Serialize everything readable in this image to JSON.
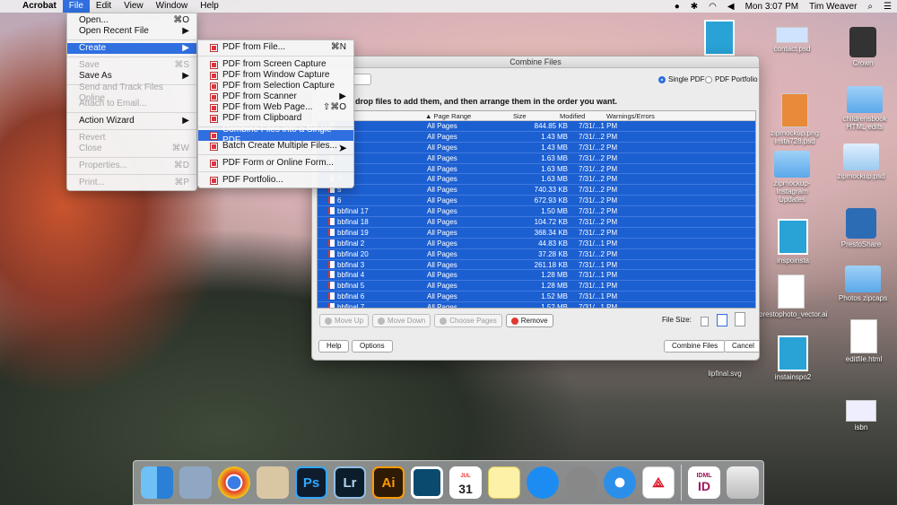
{
  "menubar": {
    "apple": "",
    "app_name": "Acrobat",
    "items": [
      "File",
      "Edit",
      "View",
      "Window",
      "Help"
    ],
    "active": "File",
    "clock": "Mon 3:07 PM",
    "user": "Tim Weaver"
  },
  "file_menu": [
    {
      "label": "Open...",
      "shortcut": "⌘O"
    },
    {
      "label": "Open Recent File",
      "shortcut": "▶"
    },
    {
      "sep": true
    },
    {
      "label": "Create",
      "shortcut": "▶",
      "highlight": true
    },
    {
      "sep": true
    },
    {
      "label": "Save",
      "shortcut": "⌘S",
      "disabled": true
    },
    {
      "label": "Save As",
      "shortcut": "▶"
    },
    {
      "sep": true
    },
    {
      "label": "Send and Track Files Online",
      "disabled": true
    },
    {
      "label": "Attach to Email...",
      "disabled": true
    },
    {
      "sep": true
    },
    {
      "label": "Action Wizard",
      "shortcut": "▶"
    },
    {
      "sep": true
    },
    {
      "label": "Revert",
      "disabled": true
    },
    {
      "label": "Close",
      "shortcut": "⌘W",
      "disabled": true
    },
    {
      "sep": true
    },
    {
      "label": "Properties...",
      "shortcut": "⌘D",
      "disabled": true
    },
    {
      "sep": true
    },
    {
      "label": "Print...",
      "shortcut": "⌘P",
      "disabled": true
    }
  ],
  "create_menu": [
    {
      "label": "PDF from File...",
      "shortcut": "⌘N"
    },
    {
      "sep": true
    },
    {
      "label": "PDF from Screen Capture"
    },
    {
      "label": "PDF from Window Capture"
    },
    {
      "label": "PDF from Selection Capture"
    },
    {
      "label": "PDF from Scanner",
      "shortcut": "▶"
    },
    {
      "label": "PDF from Web Page...",
      "shortcut": "⇧⌘O"
    },
    {
      "label": "PDF from Clipboard"
    },
    {
      "sep": true
    },
    {
      "label": "Combine Files into a Single PDF...",
      "highlight": true
    },
    {
      "label": "Batch Create Multiple Files..."
    },
    {
      "sep": true
    },
    {
      "label": "PDF Form or Online Form..."
    },
    {
      "sep": true
    },
    {
      "label": "PDF Portfolio..."
    }
  ],
  "combine_window": {
    "title": "Combine Files",
    "dropdown": "...",
    "radio_single": "Single PDF",
    "radio_portfolio": "PDF Portfolio",
    "instruction": "drop files to add them, and then arrange them in the order you want.",
    "columns": {
      "range": "Page Range",
      "size": "Size",
      "modified": "Modified",
      "warnings": "Warnings/Errors"
    },
    "rows": [
      {
        "name": "",
        "range": "All Pages",
        "size": "844.85 KB",
        "modified": "7/31/...1 PM"
      },
      {
        "name": "0",
        "range": "All Pages",
        "size": "1.43 MB",
        "modified": "7/31/...2 PM"
      },
      {
        "name": "1",
        "range": "All Pages",
        "size": "1.43 MB",
        "modified": "7/31/...2 PM"
      },
      {
        "name": "2",
        "range": "All Pages",
        "size": "1.63 MB",
        "modified": "7/31/...2 PM"
      },
      {
        "name": "3",
        "range": "All Pages",
        "size": "1.63 MB",
        "modified": "7/31/...2 PM"
      },
      {
        "name": "4",
        "range": "All Pages",
        "size": "1.63 MB",
        "modified": "7/31/...2 PM"
      },
      {
        "name": "5",
        "range": "All Pages",
        "size": "740.33 KB",
        "modified": "7/31/...2 PM"
      },
      {
        "name": "6",
        "range": "All Pages",
        "size": "672.93 KB",
        "modified": "7/31/...2 PM"
      },
      {
        "name": "bbfinal 17",
        "range": "All Pages",
        "size": "1.50 MB",
        "modified": "7/31/...2 PM"
      },
      {
        "name": "bbfinal 18",
        "range": "All Pages",
        "size": "104.72 KB",
        "modified": "7/31/...2 PM"
      },
      {
        "name": "bbfinal 19",
        "range": "All Pages",
        "size": "368.34 KB",
        "modified": "7/31/...2 PM"
      },
      {
        "name": "bbfinal 2",
        "range": "All Pages",
        "size": "44.83 KB",
        "modified": "7/31/...1 PM"
      },
      {
        "name": "bbfinal 20",
        "range": "All Pages",
        "size": "37.28 KB",
        "modified": "7/31/...2 PM"
      },
      {
        "name": "bbfinal 3",
        "range": "All Pages",
        "size": "261.18 KB",
        "modified": "7/31/...1 PM"
      },
      {
        "name": "bbfinal 4",
        "range": "All Pages",
        "size": "1.28 MB",
        "modified": "7/31/...1 PM"
      },
      {
        "name": "bbfinal 5",
        "range": "All Pages",
        "size": "1.28 MB",
        "modified": "7/31/...1 PM"
      },
      {
        "name": "bbfinal 6",
        "range": "All Pages",
        "size": "1.52 MB",
        "modified": "7/31/...1 PM"
      },
      {
        "name": "bbfinal 7",
        "range": "All Pages",
        "size": "1.52 MB",
        "modified": "7/31/...1 PM"
      }
    ],
    "buttons": {
      "move_up": "Move Up",
      "move_down": "Move Down",
      "choose_pages": "Choose Pages",
      "remove": "Remove"
    },
    "file_size_label": "File Size:",
    "help": "Help",
    "options": "Options",
    "combine": "Combine Files",
    "cancel": "Cancel"
  },
  "desktop_icons": [
    {
      "label": "contact.psd"
    },
    {
      "label": "Crown"
    },
    {
      "label": "zipmockup.png"
    },
    {
      "label": "insta728.psd"
    },
    {
      "label": "childrensbook"
    },
    {
      "label": "HTML edits"
    },
    {
      "label": "zipmockup-Instagram Updates"
    },
    {
      "label": "zipmockup.psd"
    },
    {
      "label": "inspoinsta"
    },
    {
      "label": "PrestoShare"
    },
    {
      "label": "prestophoto_vector.ai"
    },
    {
      "label": "Photos zipcaps"
    },
    {
      "label": "instainspo2"
    },
    {
      "label": "editfile.html"
    },
    {
      "label": "lipfinal.svg"
    },
    {
      "label": "isbn"
    }
  ],
  "dock": {
    "photoshop": "Ps",
    "lightroom": "Lr",
    "illustrator": "Ai",
    "calendar_month": "JUL",
    "calendar_day": "31",
    "indesign": "ID",
    "idml": "IDML"
  }
}
